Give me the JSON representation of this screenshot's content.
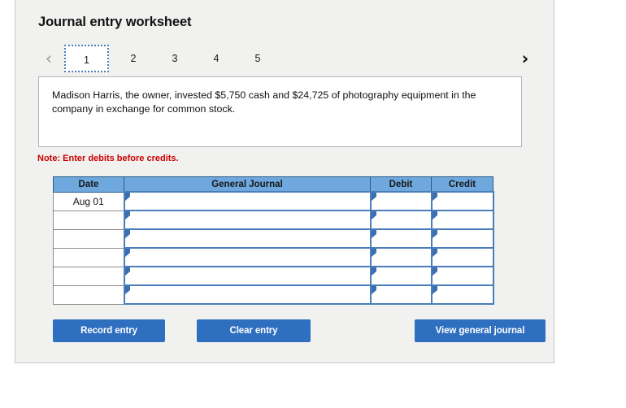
{
  "card": {
    "title": "Journal entry worksheet"
  },
  "pager": {
    "prev_icon": "chevron-left-icon",
    "prev_glyph": "‹",
    "next_icon": "chevron-right-icon",
    "next_glyph": "›",
    "tabs": [
      {
        "label": "1",
        "active": true
      },
      {
        "label": "2",
        "active": false
      },
      {
        "label": "3",
        "active": false
      },
      {
        "label": "4",
        "active": false
      },
      {
        "label": "5",
        "active": false
      }
    ]
  },
  "prompt": {
    "text": "Madison Harris, the owner, invested $5,750 cash and $24,725 of photography equipment in the company in exchange for common stock."
  },
  "note": {
    "text": "Note: Enter debits before credits."
  },
  "journal": {
    "headers": [
      "Date",
      "General Journal",
      "Debit",
      "Credit"
    ],
    "rows": [
      {
        "date": "Aug 01",
        "general_journal": "",
        "debit": "",
        "credit": ""
      },
      {
        "date": "",
        "general_journal": "",
        "debit": "",
        "credit": ""
      },
      {
        "date": "",
        "general_journal": "",
        "debit": "",
        "credit": ""
      },
      {
        "date": "",
        "general_journal": "",
        "debit": "",
        "credit": ""
      },
      {
        "date": "",
        "general_journal": "",
        "debit": "",
        "credit": ""
      },
      {
        "date": "",
        "general_journal": "",
        "debit": "",
        "credit": ""
      }
    ]
  },
  "buttons": {
    "record": "Record entry",
    "clear": "Clear entry",
    "view": "View general journal"
  },
  "colors": {
    "header_blue": "#6fa8dc",
    "button_blue": "#2f6fc0",
    "note_red": "#cc0000",
    "cell_border_blue": "#4a7ebb",
    "card_bg": "#f1f1f0"
  }
}
